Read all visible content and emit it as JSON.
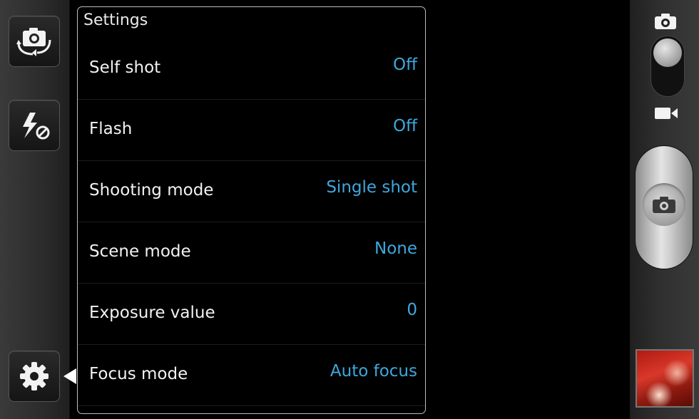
{
  "left_toolbar": {
    "buttons": [
      {
        "icon": "camera-switch-icon"
      },
      {
        "icon": "flash-off-icon"
      },
      {
        "icon": "gear-icon"
      }
    ]
  },
  "settings": {
    "title": "Settings",
    "rows": [
      {
        "label": "Self shot",
        "value": "Off"
      },
      {
        "label": "Flash",
        "value": "Off"
      },
      {
        "label": "Shooting mode",
        "value": "Single shot"
      },
      {
        "label": "Scene mode",
        "value": "None"
      },
      {
        "label": "Exposure value",
        "value": "0"
      },
      {
        "label": "Focus mode",
        "value": "Auto focus"
      }
    ]
  },
  "right_bar": {
    "mode": "camera",
    "icons": [
      "camera-icon",
      "video-camera-icon",
      "shutter-camera-icon"
    ]
  },
  "colors": {
    "value_accent": "#3ea8dd",
    "panel_border": "#bdbdbd"
  }
}
